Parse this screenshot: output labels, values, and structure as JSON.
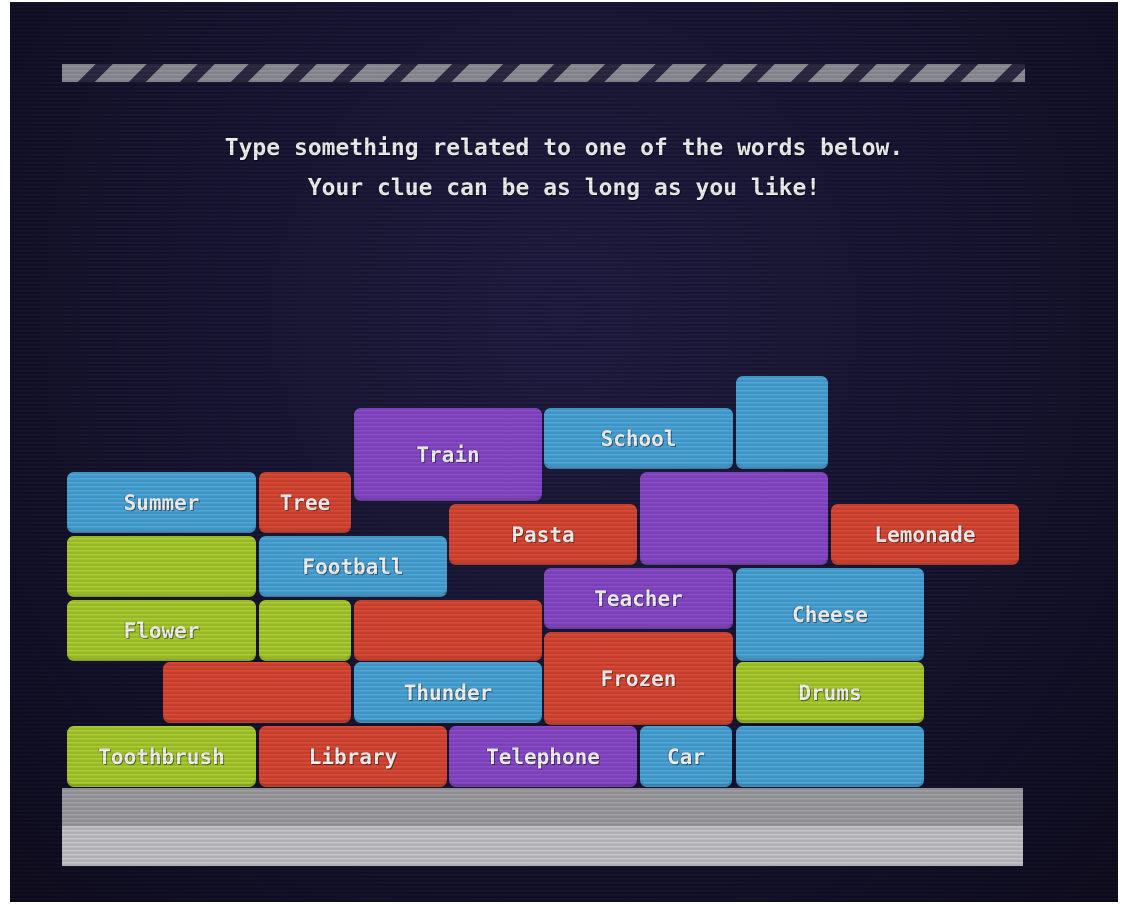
{
  "instructions": {
    "line1": "Type something related to one of the words below.",
    "line2": "Your clue can be as long as you like!"
  },
  "colors": {
    "blue": "#48a4d8",
    "red": "#d94632",
    "purple": "#8748c9",
    "green": "#a8cc2c",
    "floor_dark": "#9d9da3",
    "floor_light": "#c3c3c8"
  },
  "blocks": [
    {
      "word": "Summer",
      "color": "blue"
    },
    {
      "word": "Tree",
      "color": "red"
    },
    {
      "word": "Train",
      "color": "purple"
    },
    {
      "word": "School",
      "color": "blue"
    },
    {
      "word": "",
      "color": "blue"
    },
    {
      "word": "",
      "color": "purple"
    },
    {
      "word": "Pasta",
      "color": "red"
    },
    {
      "word": "Lemonade",
      "color": "red"
    },
    {
      "word": "",
      "color": "green"
    },
    {
      "word": "Football",
      "color": "blue"
    },
    {
      "word": "Flower",
      "color": "green"
    },
    {
      "word": "",
      "color": "green"
    },
    {
      "word": "",
      "color": "red"
    },
    {
      "word": "Teacher",
      "color": "purple"
    },
    {
      "word": "Cheese",
      "color": "blue"
    },
    {
      "word": "",
      "color": "red"
    },
    {
      "word": "Thunder",
      "color": "blue"
    },
    {
      "word": "Frozen",
      "color": "red"
    },
    {
      "word": "Drums",
      "color": "green"
    },
    {
      "word": "Toothbrush",
      "color": "green"
    },
    {
      "word": "Library",
      "color": "red"
    },
    {
      "word": "Telephone",
      "color": "purple"
    },
    {
      "word": "Car",
      "color": "blue"
    },
    {
      "word": "",
      "color": "blue"
    }
  ]
}
